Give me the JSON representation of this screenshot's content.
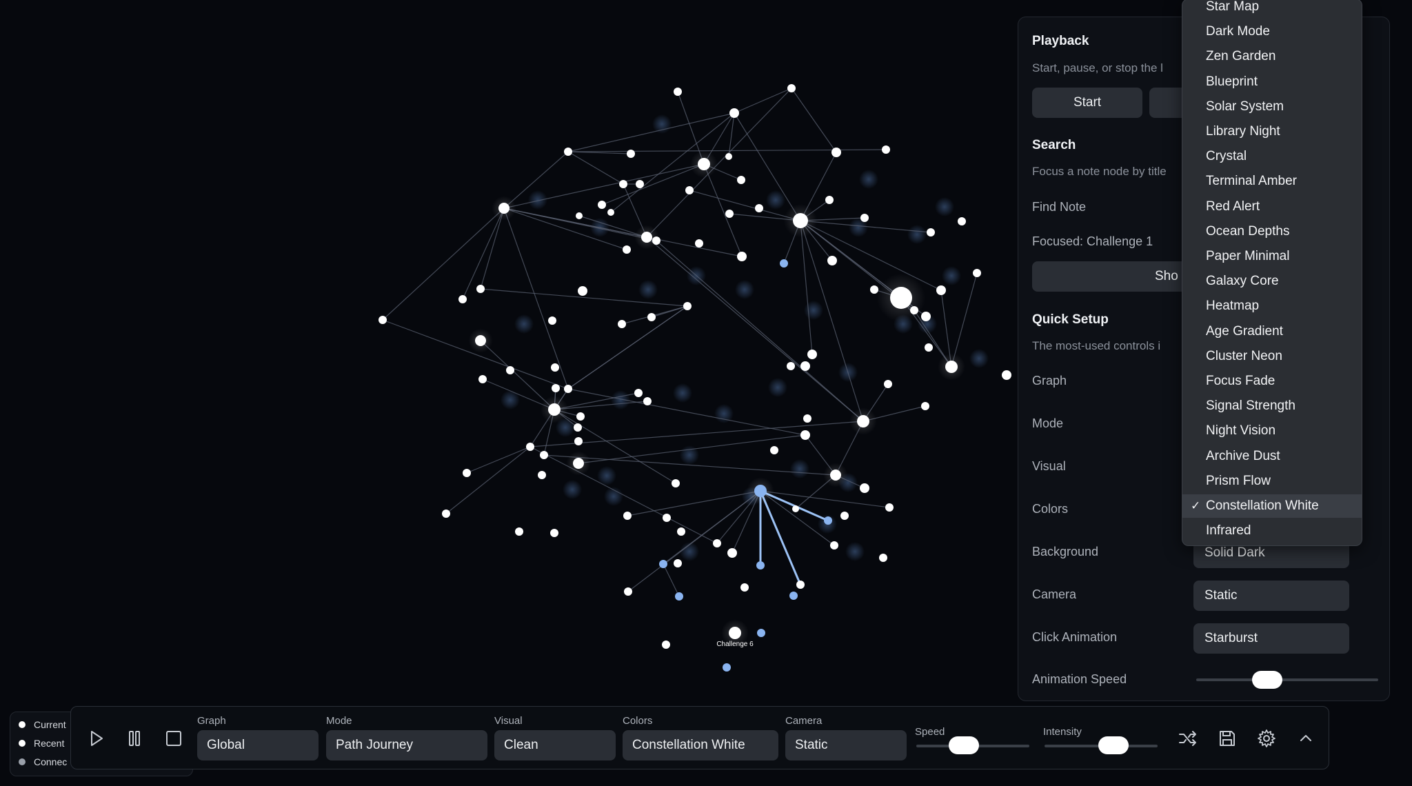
{
  "graph": {
    "focused_label": "Challenge 6"
  },
  "panel": {
    "playback": {
      "title": "Playback",
      "desc": "Start, pause, or stop the l",
      "start_label": "Start"
    },
    "search": {
      "title": "Search",
      "desc": "Focus a note node by title",
      "find_label": "Find Note",
      "focused_text": "Focused: Challenge 1",
      "show_label": "Sho"
    },
    "quick_setup": {
      "title": "Quick Setup",
      "desc": "The most-used controls i",
      "rows": [
        {
          "label": "Graph",
          "value": ""
        },
        {
          "label": "Mode",
          "value": ""
        },
        {
          "label": "Visual",
          "value": ""
        },
        {
          "label": "Colors",
          "value": ""
        },
        {
          "label": "Background",
          "value": "Solid Dark"
        },
        {
          "label": "Camera",
          "value": "Static"
        },
        {
          "label": "Click Animation",
          "value": "Starburst"
        }
      ],
      "speed_label": "Animation Speed",
      "speed_value": 0.37
    }
  },
  "dropdown": {
    "selected": "Constellation White",
    "check_glyph": "✓",
    "items": [
      "Star Map",
      "Dark Mode",
      "Zen Garden",
      "Blueprint",
      "Solar System",
      "Library Night",
      "Crystal",
      "Terminal Amber",
      "Red Alert",
      "Ocean Depths",
      "Paper Minimal",
      "Galaxy Core",
      "Heatmap",
      "Age Gradient",
      "Cluster Neon",
      "Focus Fade",
      "Signal Strength",
      "Night Vision",
      "Archive Dust",
      "Prism Flow",
      "Constellation White",
      "Infrared"
    ]
  },
  "legend": {
    "items": [
      {
        "label": "Current",
        "color": "#ffffff"
      },
      {
        "label": "Recent",
        "color": "#ffffff"
      },
      {
        "label": "Connec",
        "color": "#9aa0aa"
      }
    ]
  },
  "toolbar": {
    "icons": [
      "play-icon",
      "pause-icon",
      "stop-icon"
    ],
    "graph": {
      "label": "Graph",
      "value": "Global"
    },
    "mode": {
      "label": "Mode",
      "value": "Path Journey"
    },
    "visual": {
      "label": "Visual",
      "value": "Clean"
    },
    "colors": {
      "label": "Colors",
      "value": "Constellation White"
    },
    "camera": {
      "label": "Camera",
      "value": "Static"
    },
    "speed": {
      "label": "Speed",
      "value": 0.39
    },
    "intensity": {
      "label": "Intensity",
      "value": 0.65
    },
    "right_icons": [
      "shuffle-icon",
      "save-icon",
      "gear-icon",
      "chevron-up-icon"
    ]
  },
  "colors": {
    "background": "#06080d",
    "node_white": "#ffffff",
    "node_blue": "#8ab4f0",
    "edge": "#5a6070",
    "edge_highlight": "#9cc2f5",
    "panel_bg": "#0d1016",
    "control_bg": "#2a2e35"
  }
}
